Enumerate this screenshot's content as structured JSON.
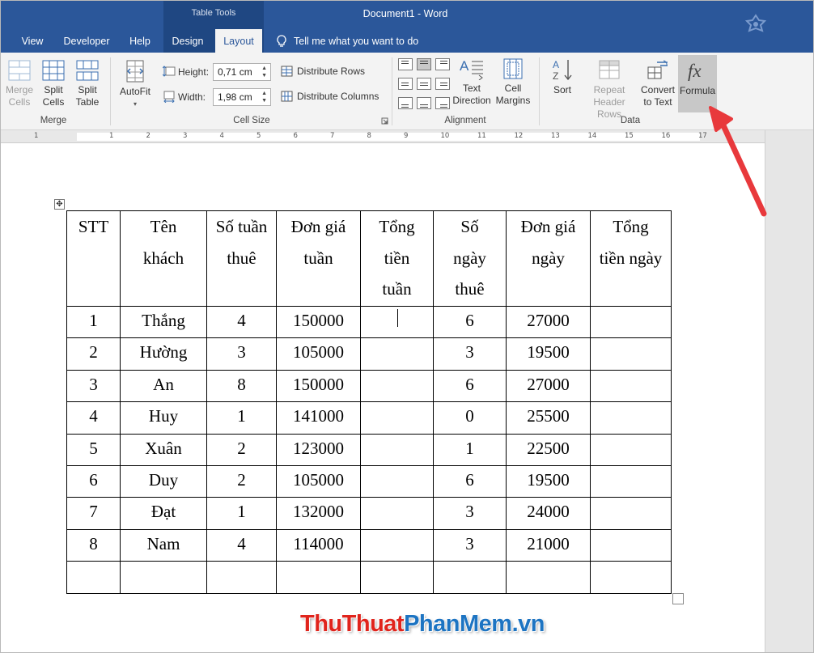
{
  "titlebar": {
    "context_tab_group": "Table Tools",
    "document_title": "Document1  -  Word",
    "tabs": [
      "View",
      "Developer",
      "Help",
      "Design",
      "Layout"
    ],
    "active_tab": "Layout",
    "tell_me": "Tell me what you want to do"
  },
  "ribbon": {
    "merge": {
      "merge_cells": [
        "Merge",
        "Cells"
      ],
      "split_cells": [
        "Split",
        "Cells"
      ],
      "split_table": [
        "Split",
        "Table"
      ],
      "group_label": "Merge"
    },
    "cell_size": {
      "autofit": "AutoFit",
      "height_label": "Height:",
      "height_value": "0,71 cm",
      "width_label": "Width:",
      "width_value": "1,98 cm",
      "distribute_rows": "Distribute Rows",
      "distribute_columns": "Distribute Columns",
      "group_label": "Cell Size"
    },
    "alignment": {
      "text_direction": [
        "Text",
        "Direction"
      ],
      "cell_margins": [
        "Cell",
        "Margins"
      ],
      "group_label": "Alignment"
    },
    "data": {
      "sort": "Sort",
      "repeat_header_rows": [
        "Repeat",
        "Header Rows"
      ],
      "convert_to_text": [
        "Convert",
        "to Text"
      ],
      "formula": "Formula",
      "group_label": "Data"
    }
  },
  "ruler": {
    "numbers": [
      "1",
      "1",
      "2",
      "3",
      "4",
      "5",
      "6",
      "7",
      "8",
      "9",
      "10",
      "11",
      "12",
      "13",
      "14",
      "15",
      "16",
      "17"
    ]
  },
  "table": {
    "headers": [
      [
        "STT"
      ],
      [
        "Tên",
        "khách"
      ],
      [
        "Số tuần",
        "thuê"
      ],
      [
        "Đơn giá",
        "tuần"
      ],
      [
        "Tổng",
        "tiền",
        "tuần"
      ],
      [
        "Số",
        "ngày",
        "thuê"
      ],
      [
        "Đơn giá",
        "ngày"
      ],
      [
        "Tổng",
        "tiền ngày"
      ]
    ],
    "rows": [
      [
        "1",
        "Thắng",
        "4",
        "150000",
        "",
        "6",
        "27000",
        ""
      ],
      [
        "2",
        "Hường",
        "3",
        "105000",
        "",
        "3",
        "19500",
        ""
      ],
      [
        "3",
        "An",
        "8",
        "150000",
        "",
        "6",
        "27000",
        ""
      ],
      [
        "4",
        "Huy",
        "1",
        "141000",
        "",
        "0",
        "25500",
        ""
      ],
      [
        "5",
        "Xuân",
        "2",
        "123000",
        "",
        "1",
        "22500",
        ""
      ],
      [
        "6",
        "Duy",
        "2",
        "105000",
        "",
        "6",
        "19500",
        ""
      ],
      [
        "7",
        "Đạt",
        "1",
        "132000",
        "",
        "3",
        "24000",
        ""
      ],
      [
        "8",
        "Nam",
        "4",
        "114000",
        "",
        "3",
        "21000",
        ""
      ],
      [
        "",
        "",
        "",
        "",
        "",
        "",
        "",
        ""
      ]
    ]
  },
  "watermark": {
    "part1": "Thu",
    "part2": "Thuat",
    "part3": "Phan",
    "part4": "Mem",
    "part5": ".vn"
  },
  "colors": {
    "word_blue": "#2b579a",
    "arrow_red": "#e8393c",
    "watermark_red": "#e0241c",
    "watermark_blue": "#1d74c2"
  }
}
